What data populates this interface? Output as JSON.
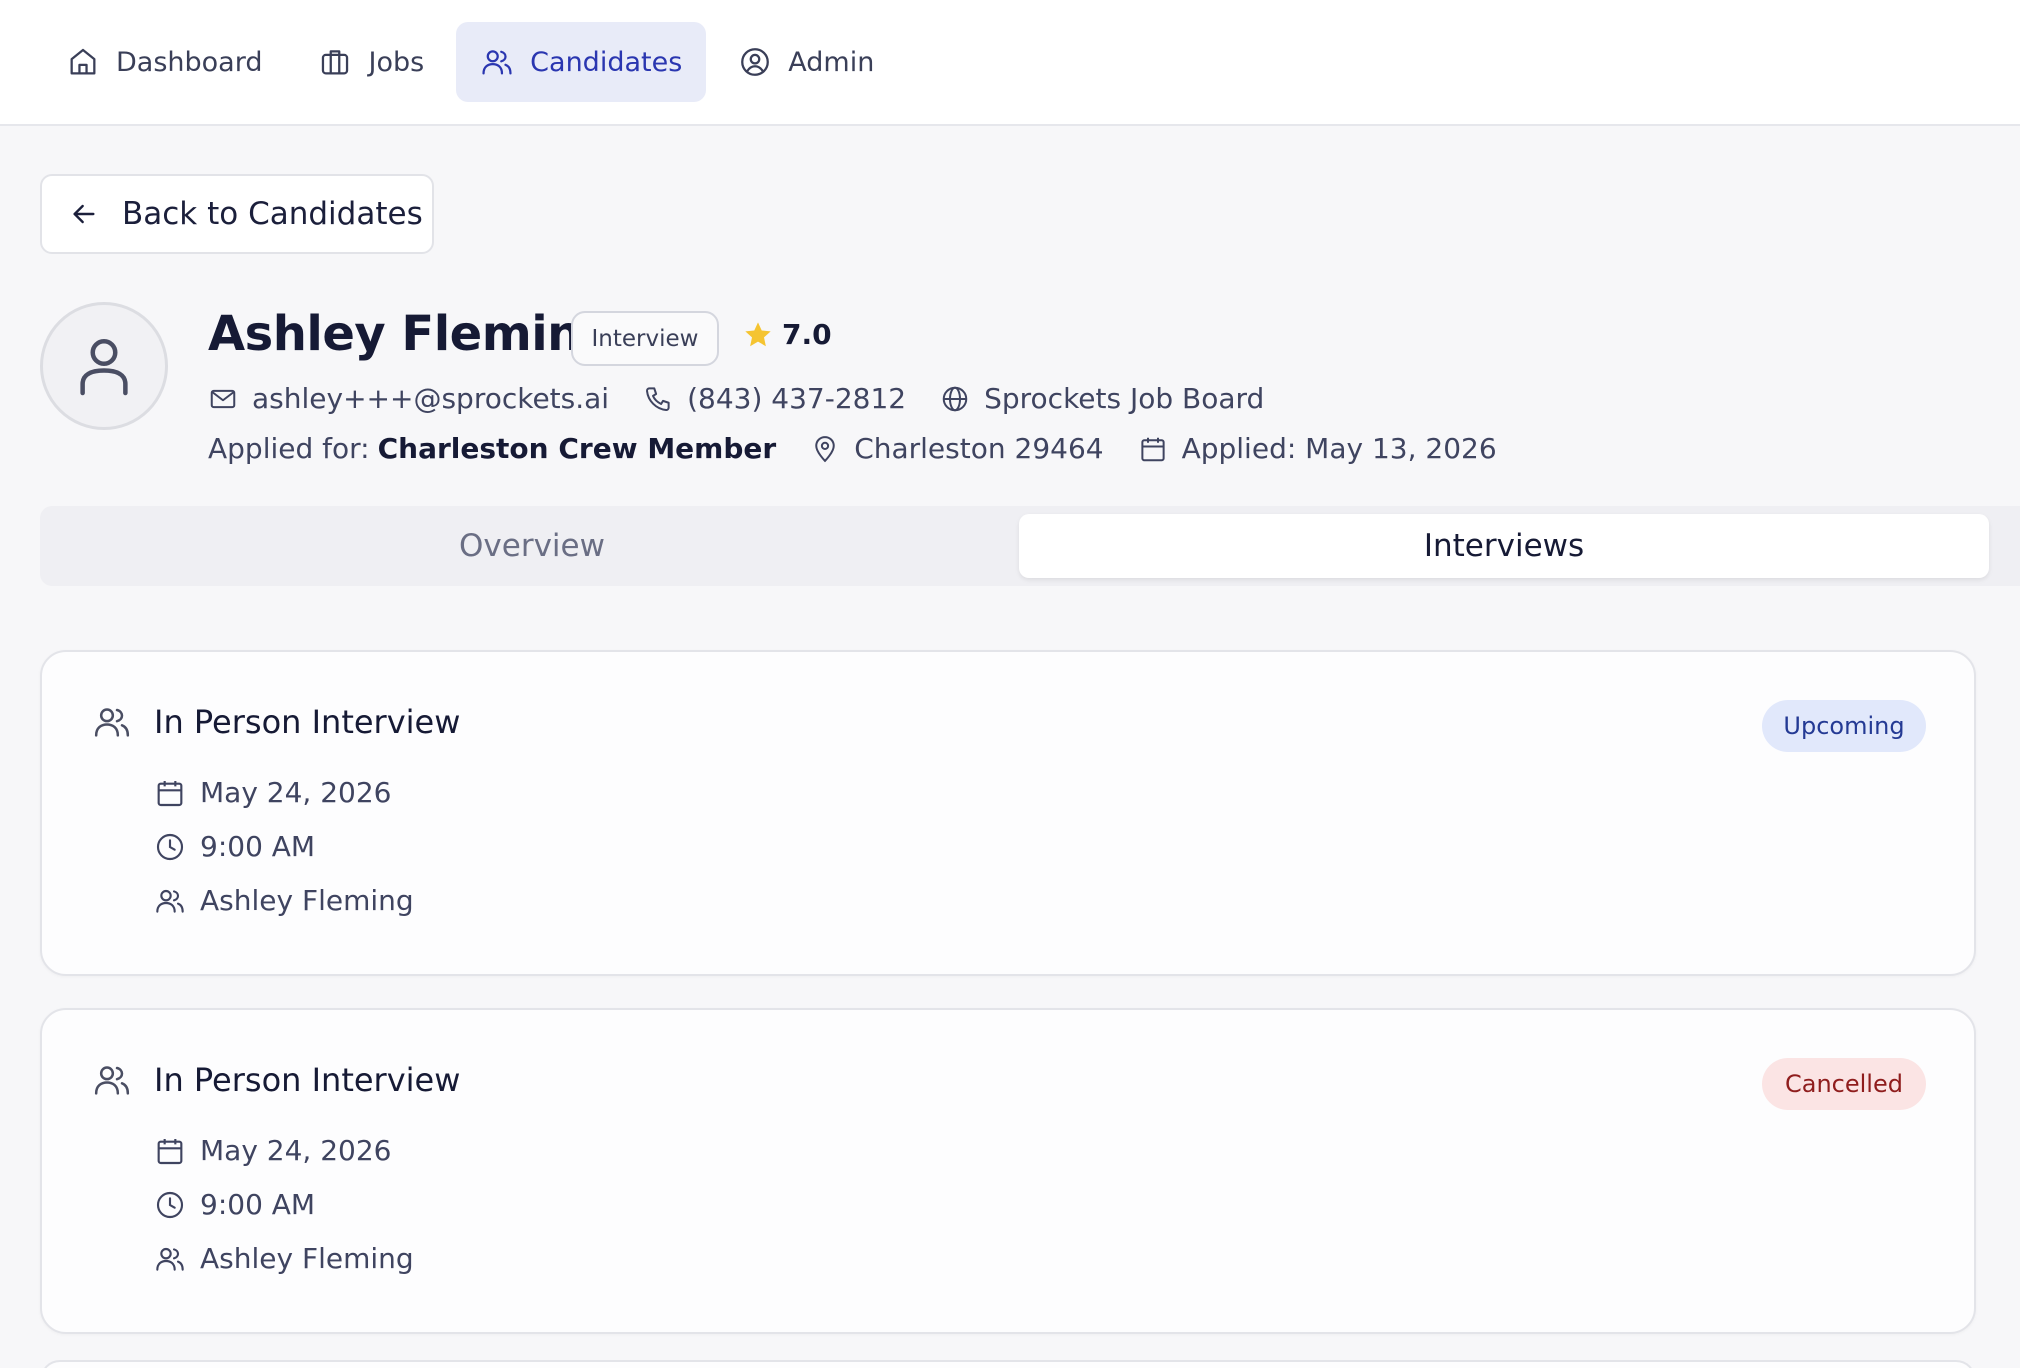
{
  "nav": {
    "items": [
      {
        "label": "Dashboard",
        "icon": "home-icon"
      },
      {
        "label": "Jobs",
        "icon": "briefcase-icon"
      },
      {
        "label": "Candidates",
        "icon": "users-icon",
        "active": true
      },
      {
        "label": "Admin",
        "icon": "user-circle-icon"
      }
    ]
  },
  "back_button": {
    "label": "Back to Candidates",
    "icon": "arrow-left-icon"
  },
  "candidate": {
    "name": "Ashley Fleming",
    "stage": "Interview",
    "rating": "7.0",
    "email": "ashley+++@sprockets.ai",
    "phone": "(843) 437-2812",
    "source": "Sprockets Job Board",
    "applied_for_label": "Applied for:",
    "applied_for_job": "Charleston Crew Member",
    "location": "Charleston 29464",
    "applied_date": "Applied: May 13, 2026"
  },
  "tabs": [
    {
      "label": "Overview",
      "active": false
    },
    {
      "label": "Interviews",
      "active": true
    }
  ],
  "interviews": [
    {
      "title": "In Person Interview",
      "status": "Upcoming",
      "date": "May 24, 2026",
      "time": "9:00 AM",
      "attendee": "Ashley Fleming"
    },
    {
      "title": "In Person Interview",
      "status": "Cancelled",
      "date": "May 24, 2026",
      "time": "9:00 AM",
      "attendee": "Ashley Fleming"
    }
  ],
  "colors": {
    "accent": "#2a36b0",
    "nav_active_bg": "#e8ebf8",
    "star": "#f5c431",
    "upcoming_bg": "#e1e8fb",
    "upcoming_text": "#243a94",
    "cancelled_bg": "#fbe4e4",
    "cancelled_text": "#8f1d1d"
  }
}
